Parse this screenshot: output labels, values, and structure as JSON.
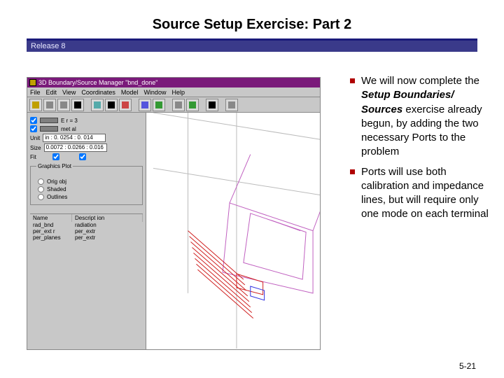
{
  "slide": {
    "title": "Source Setup Exercise: Part 2",
    "release_label": "Release 8",
    "page_number": "5-21"
  },
  "app_window": {
    "title": "3D Boundary/Source Manager \"bnd_done\"",
    "menus": [
      "File",
      "Edit",
      "View",
      "Coordinates",
      "Model",
      "Window",
      "Help"
    ],
    "toolbar_glyphs": [
      {
        "name": "open-icon",
        "fill": "#c0a000"
      },
      {
        "name": "zoom-icon",
        "fill": "#888"
      },
      {
        "name": "zoom-extents-icon",
        "fill": "#888"
      },
      {
        "name": "cursor-icon",
        "fill": "#000"
      },
      {
        "name": "sep"
      },
      {
        "name": "box-icon",
        "fill": "#5aa"
      },
      {
        "name": "wire-icon",
        "fill": "#000"
      },
      {
        "name": "hide-icon",
        "fill": "#c44"
      },
      {
        "name": "sep"
      },
      {
        "name": "wave-icon",
        "fill": "#55d"
      },
      {
        "name": "mesh-icon",
        "fill": "#393"
      },
      {
        "name": "sep"
      },
      {
        "name": "model-icon",
        "fill": "#888"
      },
      {
        "name": "play-icon",
        "fill": "#393"
      },
      {
        "name": "sep"
      },
      {
        "name": "list-icon",
        "fill": "#000"
      },
      {
        "name": "sep"
      },
      {
        "name": "layers-icon",
        "fill": "#888"
      }
    ],
    "visibility": [
      {
        "label": "E r = 3",
        "swatch": "#808080",
        "checked": true
      },
      {
        "label": "met al",
        "swatch": "#808080",
        "checked": true
      }
    ],
    "unit_row": {
      "prefix": "Unit",
      "value": "in : 0. 0254 : 0. 014"
    },
    "size_row": {
      "prefix": "Size",
      "value": "0.0072 : 0.0266 : 0.016"
    },
    "fit_row_label": "Fit",
    "graphics_group": {
      "legend": "Graphics Plot",
      "options": [
        "Orig obj",
        "Shaded",
        "Outlines"
      ]
    },
    "list": {
      "headers": [
        "Name",
        "Descript ion"
      ],
      "rows": [
        [
          "rad_bnd",
          "radiation"
        ],
        [
          "per_ext r",
          "per_extr"
        ],
        [
          "per_planes",
          "per_extr"
        ]
      ]
    }
  },
  "bullets": [
    {
      "pre": "We will now complete the ",
      "em": "Setup Boundaries/ Sources",
      "post": " exercise already begun, by adding the two necessary Ports to the problem"
    },
    {
      "pre": "Ports will use both calibration and impedance lines, but will require only one mode on each terminal",
      "em": "",
      "post": ""
    }
  ]
}
